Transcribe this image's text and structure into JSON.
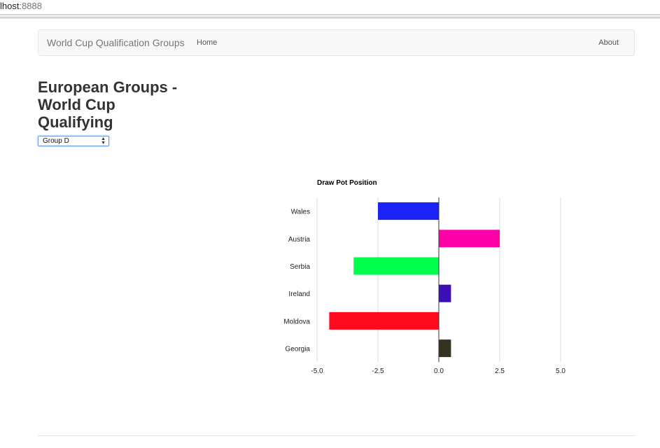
{
  "browser": {
    "address_host": "lhost",
    "address_port": ":8888"
  },
  "navbar": {
    "brand": "World Cup Qualification Groups",
    "home_label": "Home",
    "about_label": "About"
  },
  "page": {
    "title": "European Groups - World Cup Qualifying",
    "group_select": {
      "selected": "Group D"
    }
  },
  "chart_data": {
    "type": "bar",
    "orientation": "horizontal",
    "title": "Draw Pot Position",
    "categories": [
      "Wales",
      "Austria",
      "Serbia",
      "Ireland",
      "Moldova",
      "Georgia"
    ],
    "values": [
      -2.5,
      2.5,
      -3.5,
      0.5,
      -4.5,
      0.5
    ],
    "colors": [
      "#1a22f5",
      "#ff00a8",
      "#00ff4c",
      "#3b0fb5",
      "#ff0a1e",
      "#35321f"
    ],
    "x_ticks": [
      "-5.0",
      "-2.5",
      "0.0",
      "2.5",
      "5.0"
    ],
    "xlim": [
      -5,
      5
    ],
    "grid": true,
    "legend": "none"
  }
}
